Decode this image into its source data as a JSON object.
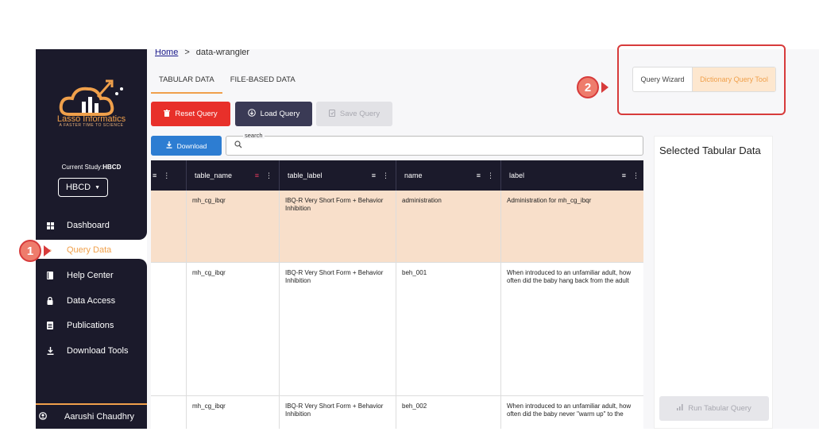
{
  "breadcrumb": {
    "home": "Home",
    "separator": ">",
    "current": "data-wrangler"
  },
  "tabs": [
    {
      "label": "TABULAR DATA"
    },
    {
      "label": "FILE-BASED DATA"
    }
  ],
  "toolbar": {
    "reset": "Reset Query",
    "load": "Load Query",
    "save": "Save Query",
    "download": "Download"
  },
  "search": {
    "label": "search",
    "placeholder": ""
  },
  "query_mode": {
    "wizard": "Query Wizard",
    "dictionary": "Dictionary Query Tool"
  },
  "sidebar": {
    "brand": "Lasso Informatics",
    "tagline": "A FASTER TIME TO SCIENCE",
    "current_study_label": "Current Study:",
    "current_study_value": "HBCD",
    "study_select": "HBCD",
    "items": [
      {
        "label": "Dashboard",
        "icon": "dashboard-icon",
        "glyph": "▪"
      },
      {
        "label": "Query Data",
        "icon": "query-icon",
        "glyph": "⌕"
      },
      {
        "label": "Help Center",
        "icon": "book-icon",
        "glyph": "▮"
      },
      {
        "label": "Data Access",
        "icon": "lock-icon",
        "glyph": "🔒"
      },
      {
        "label": "Publications",
        "icon": "document-icon",
        "glyph": "▤"
      },
      {
        "label": "Download Tools",
        "icon": "download-icon",
        "glyph": "⤓"
      }
    ],
    "user": "Aarushi Chaudhry"
  },
  "table": {
    "columns": [
      "",
      "table_name",
      "table_label",
      "name",
      "label"
    ],
    "rows": [
      {
        "table_name": "mh_cg_ibqr",
        "table_label": "IBQ-R Very Short Form + Behavior Inhibition",
        "name": "administration",
        "label": "Administration for mh_cg_ibqr"
      },
      {
        "table_name": "mh_cg_ibqr",
        "table_label": "IBQ-R Very Short Form + Behavior Inhibition",
        "name": "beh_001",
        "label": "When introduced to an unfamiliar adult, how often did the baby hang back from the adult"
      },
      {
        "table_name": "mh_cg_ibqr",
        "table_label": "IBQ-R Very Short Form + Behavior Inhibition",
        "name": "beh_002",
        "label": "When introduced to an unfamiliar adult, how often did the baby never \"warm up\" to the"
      }
    ]
  },
  "right_panel": {
    "title": "Selected Tabular Data",
    "run": "Run Tabular Query"
  },
  "annotations": {
    "one": "1",
    "two": "2"
  },
  "colors": {
    "accent": "#f0a04b",
    "sidebar": "#1b1a2b",
    "reset": "#e8302a",
    "download": "#2d7dd2",
    "annotation": "#d73b3b"
  }
}
